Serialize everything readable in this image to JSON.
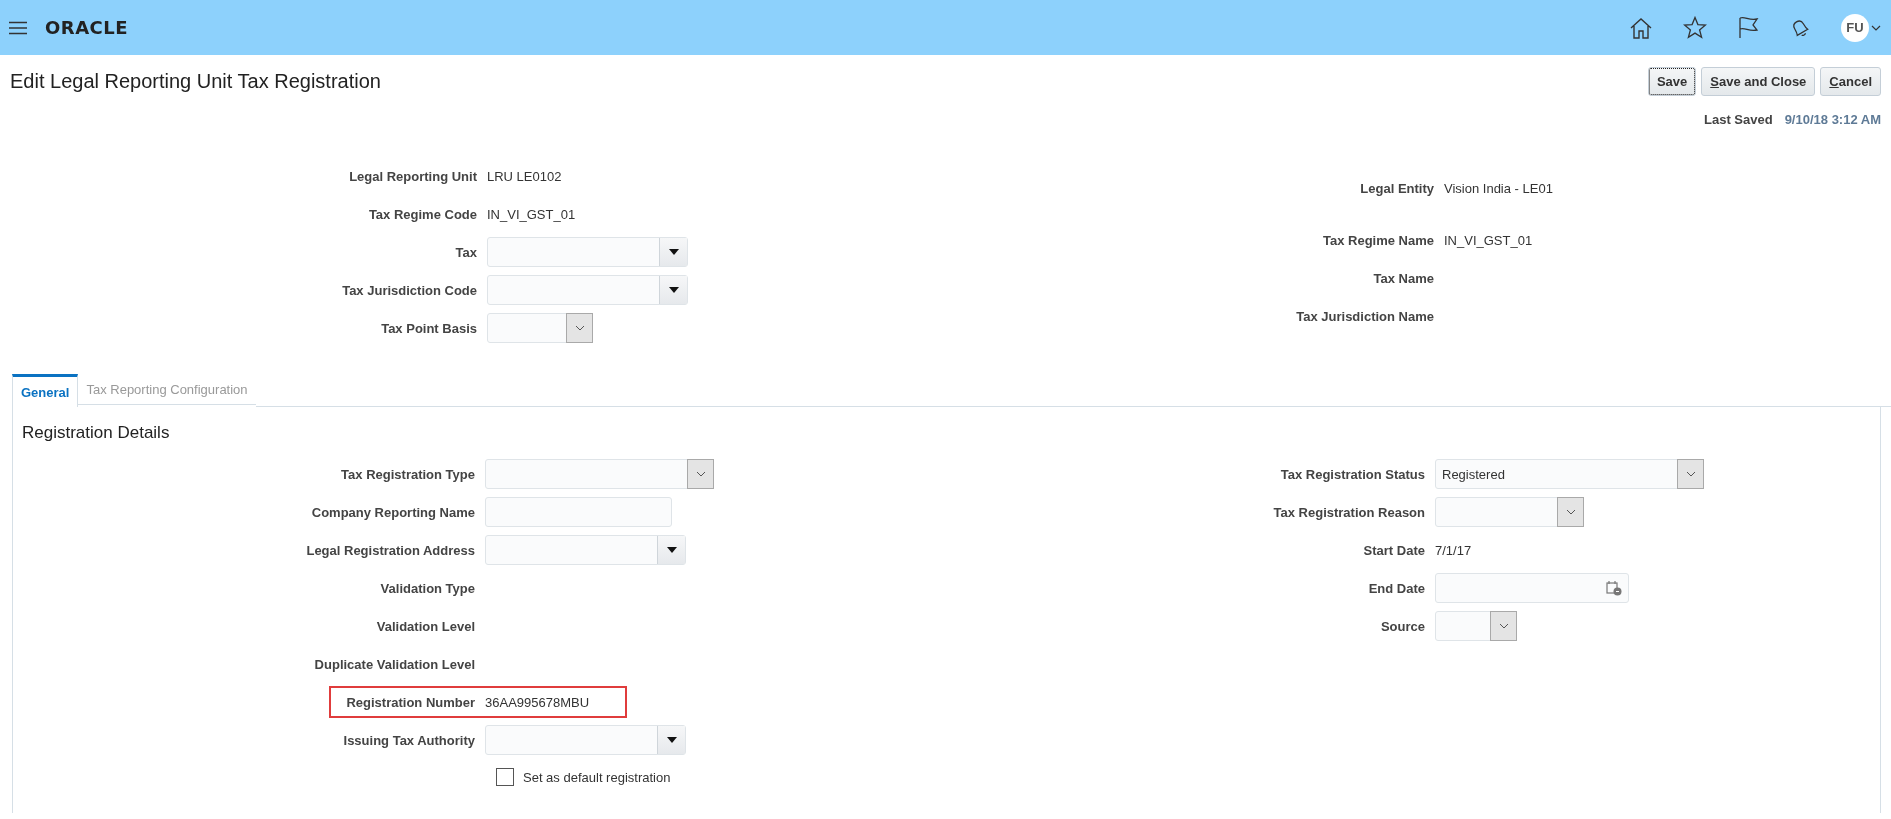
{
  "header": {
    "logo": "ORACLE",
    "avatar": "FU"
  },
  "page": {
    "title": "Edit Legal Reporting Unit Tax Registration",
    "buttons": [
      {
        "label": "Save",
        "focused": true,
        "mnemonic": false
      },
      {
        "label": "Save and Close",
        "focused": false,
        "mnemonic": true
      },
      {
        "label": "Cancel",
        "focused": false,
        "mnemonic": true
      }
    ],
    "last_saved": {
      "label": "Last Saved",
      "value": "9/10/18 3:12 AM"
    }
  },
  "summary": {
    "left": [
      {
        "label": "Legal Reporting Unit",
        "kind": "display",
        "value": "LRU LE0102"
      },
      {
        "label": "Tax Regime Code",
        "kind": "display",
        "value": "IN_VI_GST_01"
      },
      {
        "label": "Tax",
        "kind": "combo"
      },
      {
        "label": "Tax Jurisdiction Code",
        "kind": "combo"
      },
      {
        "label": "Tax Point Basis",
        "kind": "choice"
      }
    ],
    "right": [
      {
        "label": "Legal Entity",
        "kind": "display",
        "value": "Vision India - LE01"
      },
      {
        "label": "Tax Regime Name",
        "kind": "display",
        "value": "IN_VI_GST_01"
      },
      {
        "label": "Tax Name",
        "kind": "display"
      },
      {
        "label": "Tax Jurisdiction Name",
        "kind": "display"
      }
    ]
  },
  "tabs": [
    {
      "label": "General",
      "selected": true
    },
    {
      "label": "Tax Reporting Configuration",
      "selected": false
    }
  ],
  "section": {
    "title": "Registration Details",
    "left": [
      {
        "label": "Tax Registration Type",
        "kind": "choice"
      },
      {
        "label": "Company Reporting Name",
        "kind": "text"
      },
      {
        "label": "Legal Registration Address",
        "kind": "combo"
      },
      {
        "label": "Validation Type",
        "kind": "display"
      },
      {
        "label": "Validation Level",
        "kind": "display"
      },
      {
        "label": "Duplicate Validation Level",
        "kind": "display"
      },
      {
        "label": "Registration Number",
        "kind": "display",
        "value": "36AA995678MBU",
        "highlighted": true
      },
      {
        "label": "Issuing Tax Authority",
        "kind": "combo"
      }
    ],
    "checkbox": {
      "label": "Set as default registration",
      "checked": false
    },
    "right": [
      {
        "label": "Tax Registration Status",
        "kind": "choice",
        "value": "Registered"
      },
      {
        "label": "Tax Registration Reason",
        "kind": "choice"
      },
      {
        "label": "Start Date",
        "kind": "display",
        "value": "7/1/17"
      },
      {
        "label": "End Date",
        "kind": "date"
      },
      {
        "label": "Source",
        "kind": "choice"
      }
    ]
  }
}
